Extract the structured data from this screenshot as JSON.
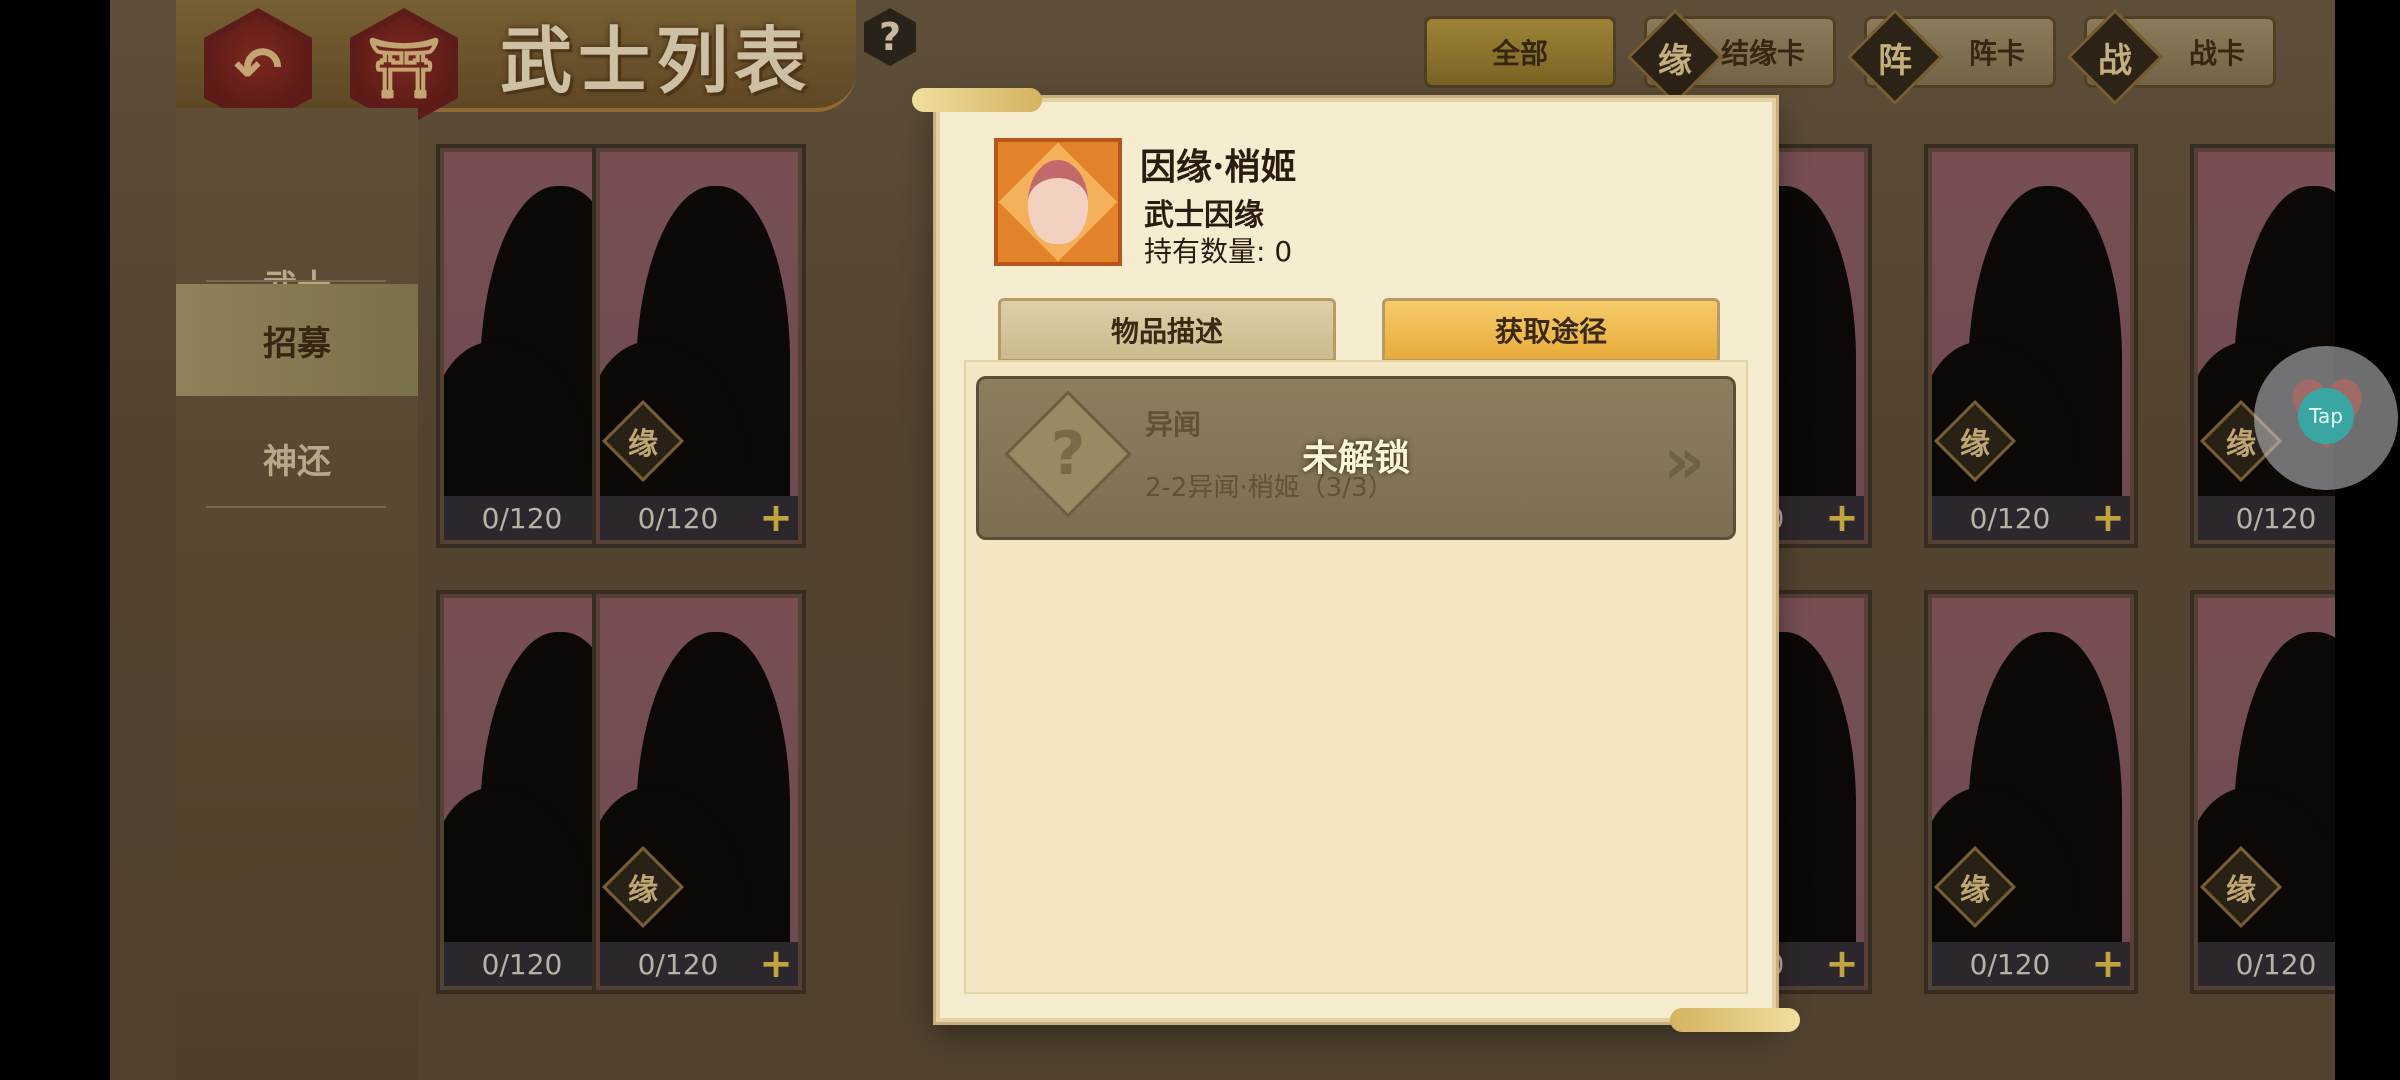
{
  "header": {
    "title": "武士列表",
    "back_glyph": "↶",
    "home_glyph": "⛩",
    "help_glyph": "?"
  },
  "filters": [
    {
      "label": "全部",
      "icon": "",
      "active": true
    },
    {
      "label": "结缘卡",
      "icon": "缘",
      "active": false
    },
    {
      "label": "阵卡",
      "icon": "阵",
      "active": false
    },
    {
      "label": "战卡",
      "icon": "战",
      "active": false
    }
  ],
  "sidebar": {
    "items": [
      {
        "label": "武士",
        "active": false
      },
      {
        "label": "招募",
        "active": true
      },
      {
        "label": "神还",
        "active": false
      }
    ]
  },
  "cards": {
    "badge_glyph": "缘",
    "plus_glyph": "+",
    "rows": [
      [
        "0/120",
        "0/120",
        "0/120",
        "0/120",
        "0/120"
      ],
      [
        "0/120",
        "0/120",
        "0/120",
        "0/120",
        "0/120"
      ]
    ]
  },
  "modal": {
    "item_name": "因缘·梢姬",
    "item_type": "武士因缘",
    "count_label": "持有数量: 0",
    "tabs": [
      {
        "label": "物品描述",
        "active": false
      },
      {
        "label": "获取途径",
        "active": true
      }
    ],
    "source": {
      "title": "异闻",
      "subtitle": "2-2异闻·梢姬（3/3）",
      "lock_text": "未解锁",
      "icon_glyph": "?"
    }
  },
  "floating": {
    "tap_label": "Tap"
  },
  "colors": {
    "accent_gold": "#e9aa3a",
    "modal_bg": "#f6ecd0",
    "header_red": "#6a1d1c"
  }
}
